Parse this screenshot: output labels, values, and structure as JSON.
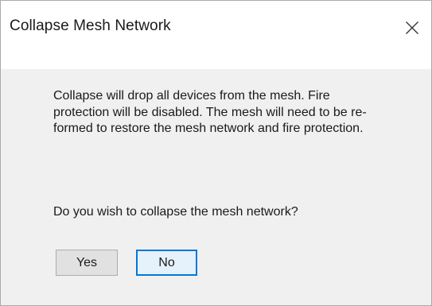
{
  "dialog": {
    "title": "Collapse Mesh Network",
    "close_icon": "close-icon",
    "message": "Collapse will drop all devices from the mesh. Fire protection will be disabled. The mesh will need to be re-formed to restore the mesh network and fire protection.",
    "question": "Do you wish to collapse the mesh network?",
    "buttons": {
      "yes_label": "Yes",
      "no_label": "No"
    },
    "default_button": "No"
  },
  "colors": {
    "title_background": "#ffffff",
    "body_background": "#f0f0f0",
    "default_button_border": "#0078d7"
  }
}
